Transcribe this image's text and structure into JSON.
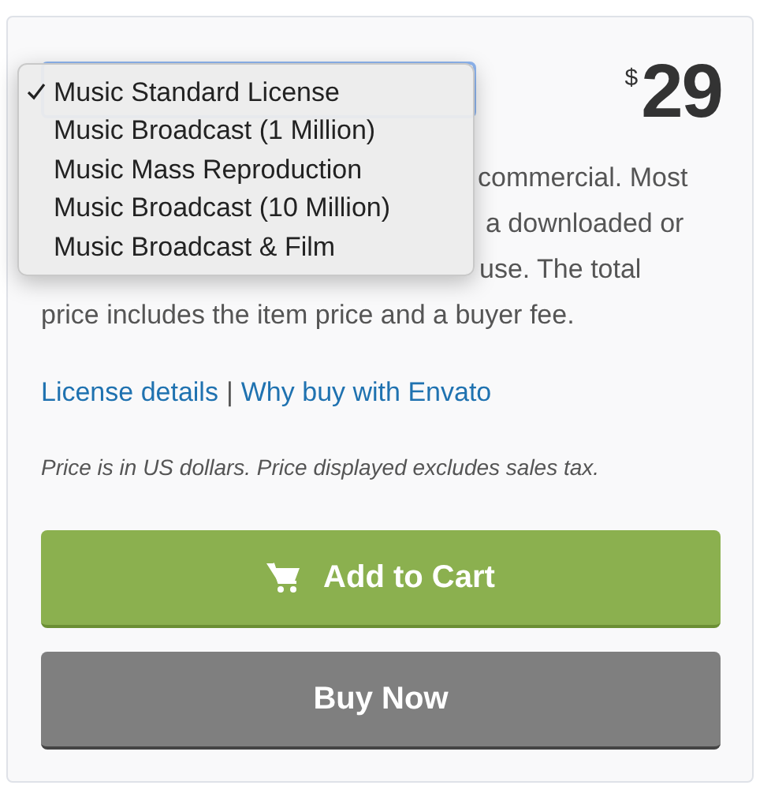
{
  "license_select": {
    "options": [
      {
        "label": "Music Standard License",
        "selected": true
      },
      {
        "label": "Music Broadcast (1 Million)",
        "selected": false
      },
      {
        "label": "Music Mass Reproduction",
        "selected": false
      },
      {
        "label": "Music Broadcast (10 Million)",
        "selected": false
      },
      {
        "label": "Music Broadcast & Film",
        "selected": false
      }
    ]
  },
  "price": {
    "currency": "$",
    "amount": "29"
  },
  "description_lines": [
    "commercial. Most",
    "a downloaded or",
    "use. The total",
    "price includes the item price and a buyer fee."
  ],
  "links": [
    {
      "label": "License details"
    },
    {
      "label": "Why buy with Envato"
    }
  ],
  "link_separator": "|",
  "note": "Price is in US dollars. Price displayed excludes sales tax.",
  "buttons": [
    {
      "label": "Add to Cart",
      "kind": "cart"
    },
    {
      "label": "Buy Now",
      "kind": "plain"
    }
  ]
}
